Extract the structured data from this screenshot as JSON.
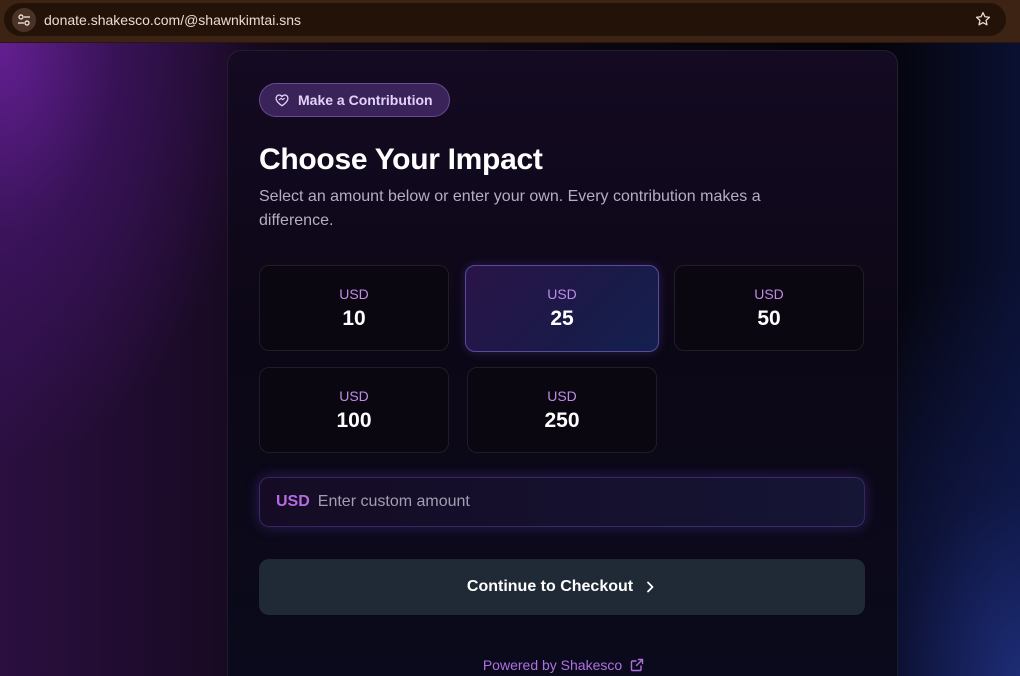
{
  "browser": {
    "url": "donate.shakesco.com/@shawnkimtai.sns",
    "site_info_icon": "tune-icon",
    "bookmark_icon": "star-icon"
  },
  "donation": {
    "badge": {
      "label": "Make a Contribution",
      "icon": "heart-handshake-icon"
    },
    "title": "Choose Your Impact",
    "subtitle": "Select an amount below or enter your own. Every contribution makes a difference.",
    "amounts": [
      {
        "currency": "USD",
        "value": "10",
        "selected": false
      },
      {
        "currency": "USD",
        "value": "25",
        "selected": true
      },
      {
        "currency": "USD",
        "value": "50",
        "selected": false
      },
      {
        "currency": "USD",
        "value": "100",
        "selected": false
      },
      {
        "currency": "USD",
        "value": "250",
        "selected": false
      }
    ],
    "custom": {
      "currency": "USD",
      "placeholder": "Enter custom amount",
      "value": ""
    },
    "checkout_label": "Continue to Checkout",
    "powered_by": "Powered by Shakesco",
    "colors": {
      "accent": "#b86be0",
      "button": "#202a36",
      "badge_bg": "#3a2358"
    }
  }
}
